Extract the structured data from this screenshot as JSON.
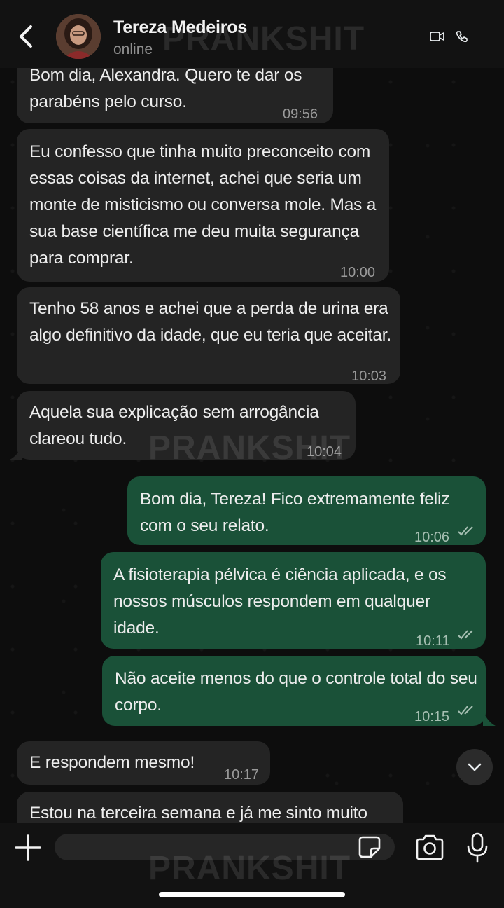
{
  "header": {
    "contact_name": "Tereza Medeiros",
    "status": "online"
  },
  "watermark": "PRANKSHIT",
  "messages": [
    {
      "direction": "in",
      "text": "Bom dia, Alexandra. Quero te dar os parabéns pelo curso.",
      "time": "09:56"
    },
    {
      "direction": "in",
      "text": "Eu confesso que tinha muito preconceito com essas coisas da internet, achei que seria um monte de misticismo ou conversa mole. Mas a sua base científica me deu muita segurança para comprar.",
      "time": "10:00"
    },
    {
      "direction": "in",
      "text": "Tenho 58 anos e achei que a perda de urina era algo definitivo da idade, que eu teria que aceitar.",
      "time": "10:03"
    },
    {
      "direction": "in",
      "text": "Aquela sua explicação sem arrogância clareou tudo.",
      "time": "10:04"
    },
    {
      "direction": "out",
      "text": "Bom dia, Tereza! Fico extremamente feliz com o seu relato.",
      "time": "10:06",
      "status": "read"
    },
    {
      "direction": "out",
      "text": "A fisioterapia pélvica é ciência aplicada, e os nossos músculos respondem em qualquer idade.",
      "time": "10:11",
      "status": "read"
    },
    {
      "direction": "out",
      "text": "Não aceite menos do que o controle total do seu corpo.",
      "time": "10:15",
      "status": "read"
    },
    {
      "direction": "in",
      "text": "E respondem mesmo!",
      "time": "10:17"
    },
    {
      "direction": "in",
      "text": "Estou na terceira semana e já me sinto muito",
      "time": ""
    }
  ],
  "composer": {
    "placeholder": ""
  },
  "colors": {
    "incoming_bubble": "#242424",
    "outgoing_bubble": "#1a5138",
    "read_ticks": "#a6bfb2"
  },
  "icons": [
    "back-arrow-icon",
    "video-call-icon",
    "phone-icon",
    "chevron-down-icon",
    "plus-icon",
    "sticker-icon",
    "camera-icon",
    "microphone-icon"
  ]
}
